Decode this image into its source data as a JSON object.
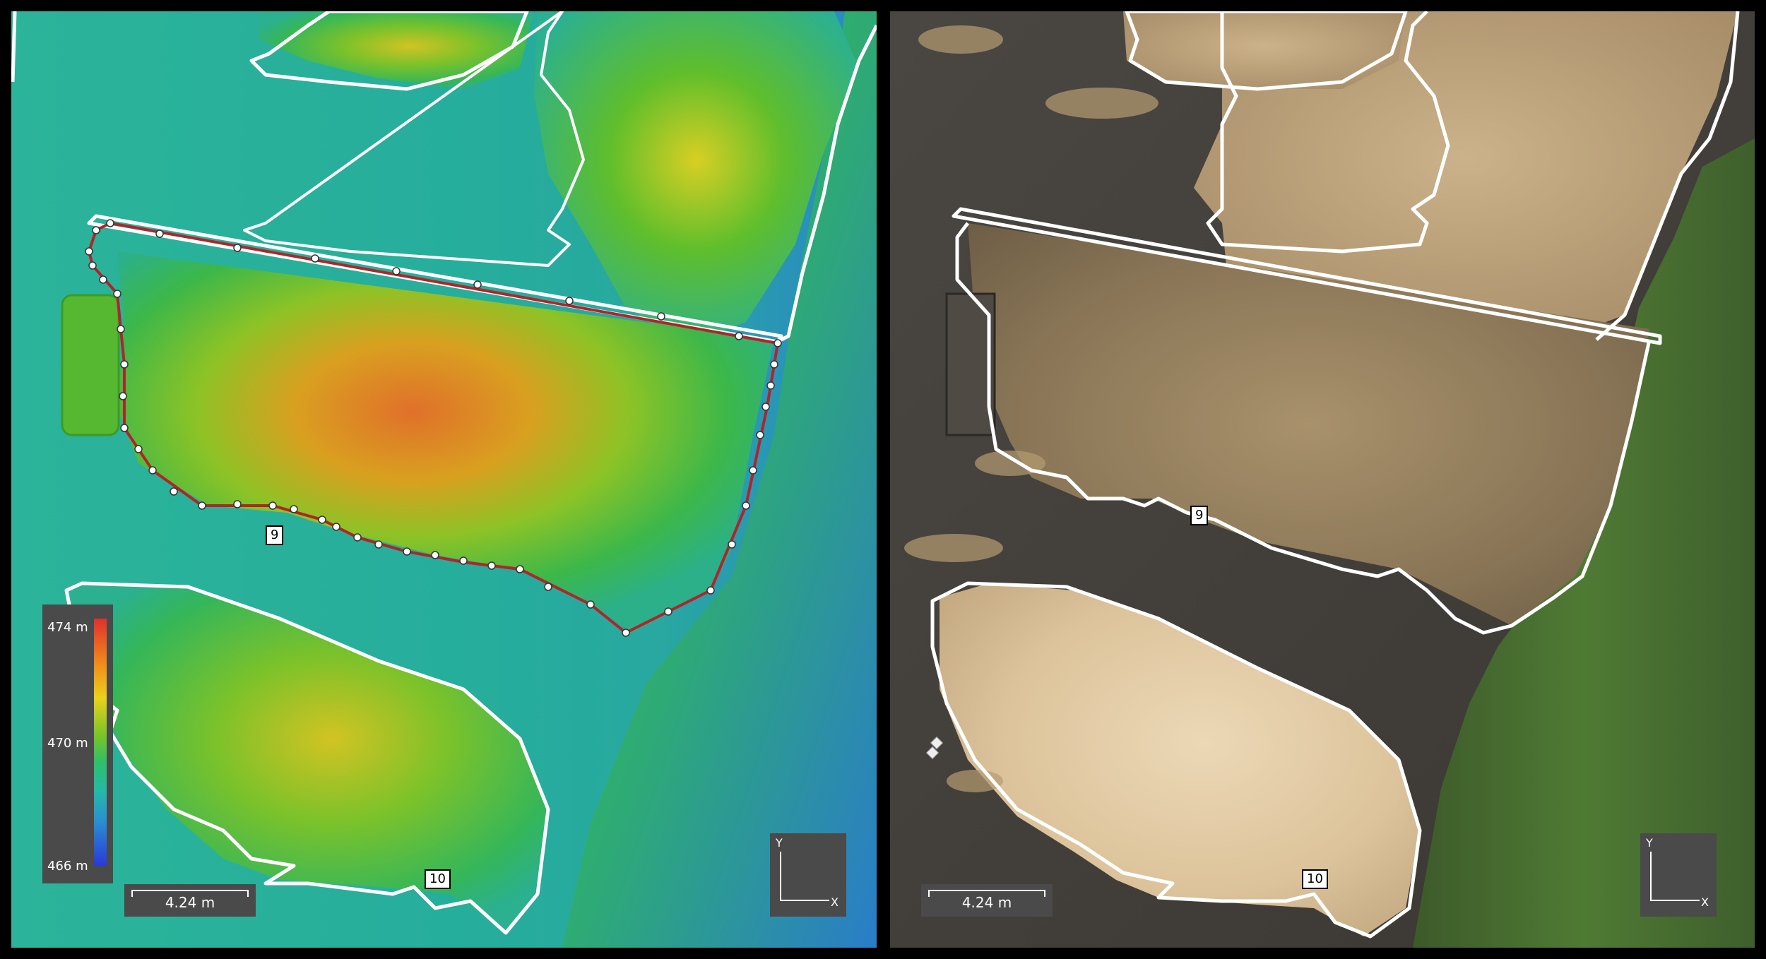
{
  "left_panel": {
    "legend": {
      "max_label": "474 m",
      "mid_label": "470 m",
      "min_label": "466 m"
    },
    "scale_label": "4.24 m",
    "axis_y": "Y",
    "axis_x": "X",
    "tag_top": "9",
    "tag_bottom": "10"
  },
  "right_panel": {
    "scale_label": "4.24 m",
    "axis_y": "Y",
    "axis_x": "X",
    "tag_top": "9",
    "tag_bottom": "10"
  },
  "colors": {
    "background": "#000000",
    "outline": "#ffffff",
    "route": "#b0252a",
    "hud": "#4a4a4a"
  }
}
